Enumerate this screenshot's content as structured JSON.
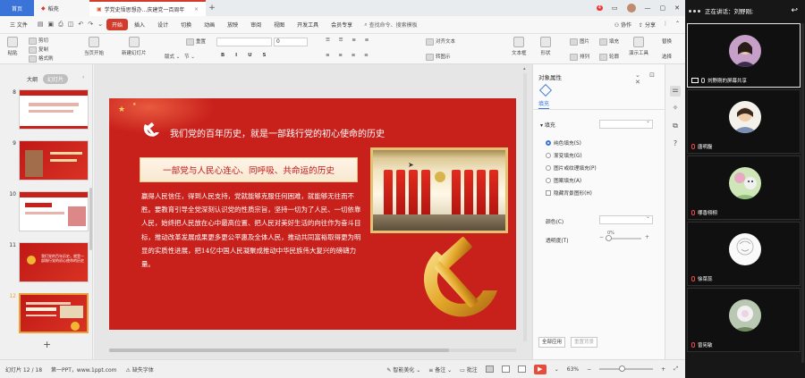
{
  "window": {
    "tabs": [
      {
        "label": "首页"
      },
      {
        "label": "稻壳"
      },
      {
        "label": "学党史悟思想办...庆建党一百周年"
      }
    ],
    "badge": "4"
  },
  "menubar": {
    "file": "三 文件",
    "items": [
      "开始",
      "插入",
      "设计",
      "切换",
      "动画",
      "放映",
      "审阅",
      "视图",
      "开发工具",
      "会员专享"
    ],
    "search": "查找命令、搜索模板",
    "right": [
      "协作",
      "分享"
    ]
  },
  "ribbon": {
    "paste": "粘贴",
    "cut": "剪切",
    "copy": "复制",
    "format_painter": "格式刷",
    "from_current": "当页开始",
    "new_slide": "新建幻灯片",
    "layout": "版式",
    "section": "节",
    "reset": "重置",
    "font_size": "0",
    "text_box": "文本框",
    "shape": "形状",
    "image": "图片",
    "fill": "填充",
    "arrange": "排列",
    "outline": "轮廓",
    "presentation_tools": "演示工具",
    "replace": "替换",
    "select": "选择",
    "convert_to_image": "转图示",
    "insert_text": "对齐文本",
    "bullets_label": "智能图形"
  },
  "leftpanel": {
    "tabs": [
      "大纲",
      "幻灯片"
    ],
    "slides": [
      {
        "num": "8"
      },
      {
        "num": "9"
      },
      {
        "num": "10"
      },
      {
        "num": "11",
        "text": "我们党的百年历史，就是一部践行党的初心使命的历史"
      },
      {
        "num": "12"
      }
    ]
  },
  "slide": {
    "title": "我们党的百年历史，就是一部践行党的初心使命的历史",
    "subtitle": "一部党与人民心连心、同呼吸、共命运的历史",
    "body": "赢得人民信任，得到人民支持，党就能够克服任何困难，就能够无往而不胜。要教育引导全党深刻认识党的性质宗旨，坚持一切为了人民、一切依靠人民，始终把人民放在心中最高位置、把人民对美好生活的向往作为奋斗目标，推动改革发展成果更多更公平惠及全体人民，推动共同富裕取得更为明显的实质性进展，把14亿中国人民凝聚成推动中华民族伟大复兴的磅礴力量。"
  },
  "rightpanel": {
    "title": "对象属性",
    "tab": "填充",
    "fill_label": "填充",
    "options": [
      {
        "label": "纯色填充(S)",
        "selected": true
      },
      {
        "label": "渐变填充(G)",
        "selected": false
      },
      {
        "label": "图片或纹理填充(P)",
        "selected": false
      },
      {
        "label": "图案填充(A)",
        "selected": false
      }
    ],
    "hide_bg": "隐藏背景图形(H)",
    "color_label": "颜色(C)",
    "transparency_label": "透明度(T)",
    "transparency_value": "0%",
    "apply_all": "全部应用",
    "reset_bg": "重置背景"
  },
  "statusbar": {
    "slide_count": "幻灯片 12 / 18",
    "theme": "第一PPT，www.1ppt.com",
    "missing_font": "缺失字体",
    "smart_beautify": "智能美化",
    "notes": "备注",
    "comments": "批注",
    "zoom": "63%"
  },
  "meeting": {
    "speaking": "正在讲话：刘野刚;",
    "participants": [
      {
        "name": "刘野刚的屏幕共享",
        "screen": true
      },
      {
        "name": "唐明磊"
      },
      {
        "name": "哪香栩栩"
      },
      {
        "name": "徐菜蕊"
      },
      {
        "name": "曾宪敏"
      }
    ]
  },
  "colors": {
    "accent": "#d23c2c",
    "slide_red": "#c8201b",
    "gold": "#e6c173",
    "blue": "#3b74d9"
  }
}
